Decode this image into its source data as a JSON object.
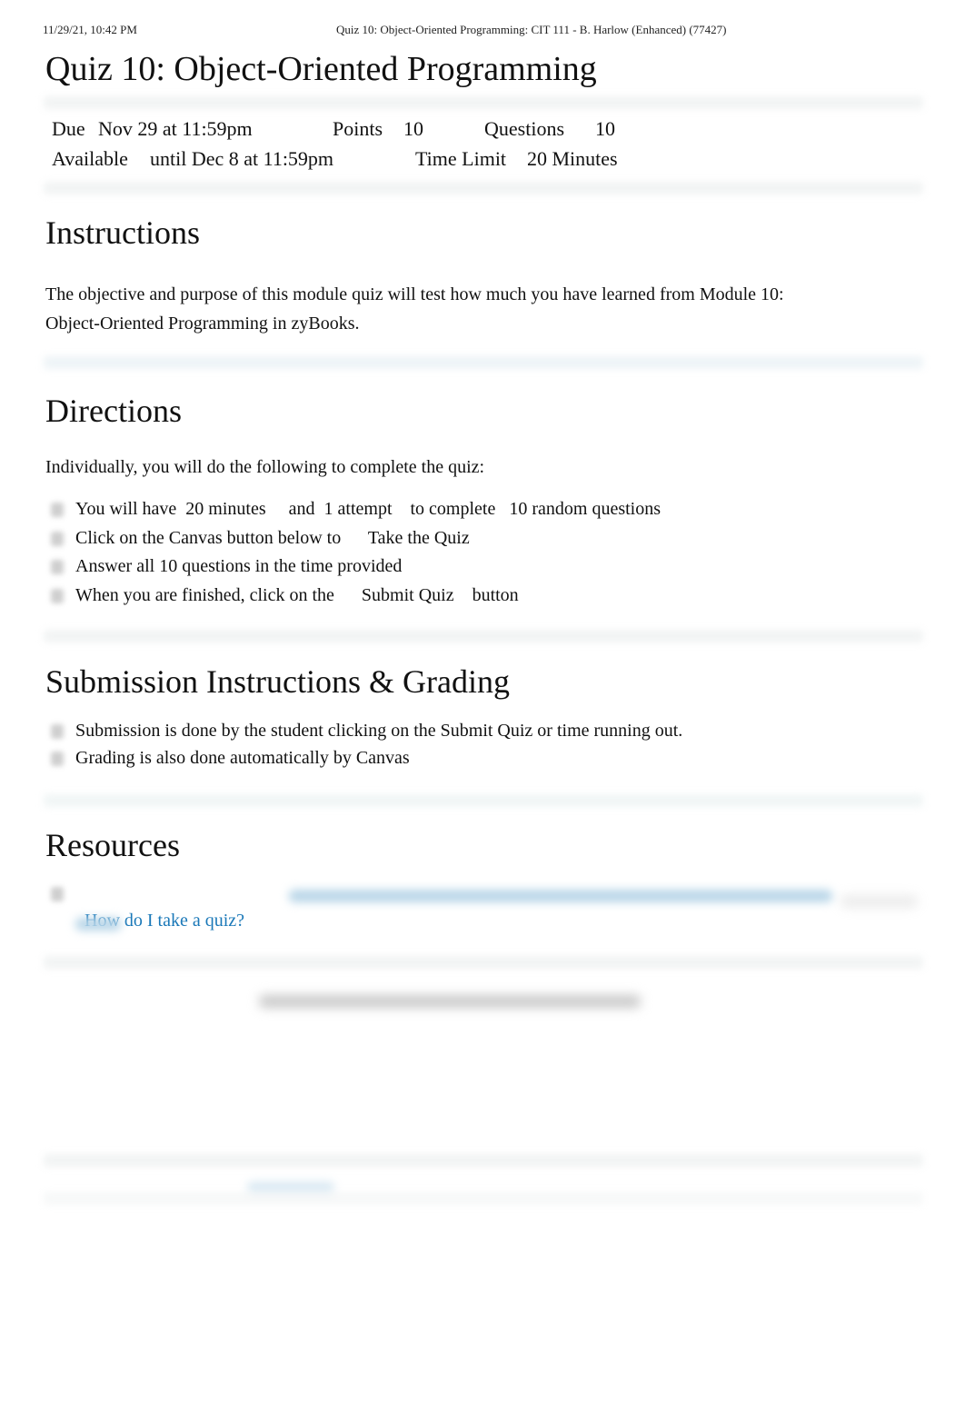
{
  "print_header": {
    "datetime": "11/29/21, 10:42 PM",
    "page_title": "Quiz 10: Object-Oriented Programming: CIT 111 - B. Harlow (Enhanced) (77427)"
  },
  "quiz": {
    "title": "Quiz 10: Object-Oriented Programming",
    "details": {
      "due_label": "Due",
      "due_value": "Nov 29 at 11:59pm",
      "points_label": "Points",
      "points_value": "10",
      "questions_label": "Questions",
      "questions_value": "10",
      "available_label": "Available",
      "available_value": "until Dec 8 at 11:59pm",
      "time_limit_label": "Time Limit",
      "time_limit_value": "20 Minutes"
    }
  },
  "sections": {
    "instructions": {
      "heading": "Instructions",
      "line1": "The objective and purpose of this module quiz will test how much you have learned from Module 10:",
      "line2": "Object-Oriented Programming in zyBooks."
    },
    "directions": {
      "heading": "Directions",
      "intro": "Individually, you will do the following to complete the quiz:",
      "items": [
        "You will have  20 minutes     and  1 attempt    to complete   10 random questions",
        "Click on the Canvas button below to      Take the Quiz",
        "Answer all 10 questions in the time provided",
        "When you are finished, click on the      Submit Quiz    button"
      ]
    },
    "submission": {
      "heading": "Submission Instructions & Grading",
      "items": [
        "Submission is done by the student clicking on the Submit Quiz or time running out.",
        "Grading is also done automatically by Canvas"
      ]
    },
    "resources": {
      "heading": "Resources",
      "links": [
        {
          "label": "How do I take a quiz?"
        }
      ]
    }
  }
}
